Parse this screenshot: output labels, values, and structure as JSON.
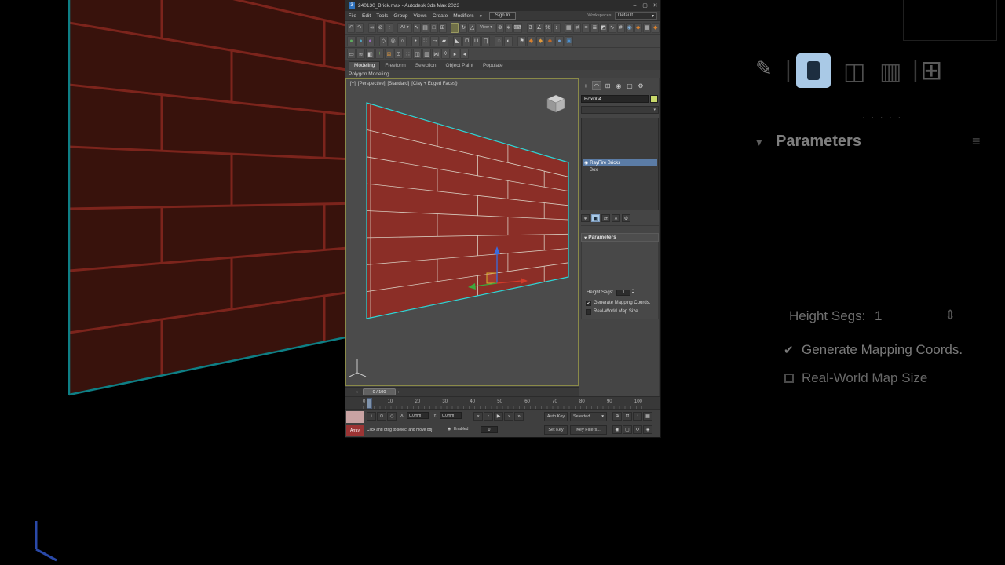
{
  "colors": {
    "brick": "#8b2e27",
    "mortar": "#d9ccbf",
    "selection": "#2fd4d4",
    "axis_x": "#d23b2a",
    "axis_y": "#3da83d",
    "axis_z": "#3a6bdd",
    "bg_brick": "#38120c",
    "bg_mortar": "#7c241c",
    "bg_selection": "#0e7f85",
    "accent_blue": "#a9c9e6",
    "swatch": "#c9d96b"
  },
  "window": {
    "title": "240130_Brick.max - Autodesk 3ds Max 2023",
    "minimize": "–",
    "maximize": "▢",
    "close": "✕"
  },
  "menubar": {
    "items": [
      "File",
      "Edit",
      "Tools",
      "Group",
      "Views",
      "Create",
      "Modifiers"
    ],
    "overflow": "»",
    "sign_in": "Sign In",
    "workspaces_label": "Workspaces:",
    "workspace_value": "Default",
    "caret": "▾"
  },
  "toolbar_row1": [
    {
      "name": "undo-icon",
      "glyph": "↶"
    },
    {
      "name": "redo-icon",
      "glyph": "↷"
    },
    {
      "sep": true
    },
    {
      "name": "select-and-link-icon",
      "glyph": "∞"
    },
    {
      "name": "unlink-selection-icon",
      "glyph": "⊘"
    },
    {
      "name": "bind-to-space-warp-icon",
      "glyph": "≀"
    },
    {
      "sep": true
    },
    {
      "name": "selection-filter-dropdown",
      "glyph": "All ▾",
      "width": 20
    },
    {
      "name": "select-object-icon",
      "glyph": "↖"
    },
    {
      "name": "select-by-name-icon",
      "glyph": "▤"
    },
    {
      "name": "selection-region-icon",
      "glyph": "□"
    },
    {
      "name": "window-crossing-icon",
      "glyph": "⊞"
    },
    {
      "sep": true
    },
    {
      "name": "select-and-move-icon",
      "glyph": "+",
      "active": true
    },
    {
      "name": "select-and-rotate-icon",
      "glyph": "↻"
    },
    {
      "name": "select-and-scale-icon",
      "glyph": "△"
    },
    {
      "name": "reference-coordinate-dropdown",
      "glyph": "View ▾",
      "width": 26
    },
    {
      "name": "use-pivot-center-icon",
      "glyph": "⊕"
    },
    {
      "name": "select-and-manipulate-icon",
      "glyph": "∗"
    },
    {
      "name": "keyboard-shortcut-override-icon",
      "glyph": "⌨"
    },
    {
      "sep": true
    },
    {
      "name": "snaps-toggle-icon",
      "glyph": "3"
    },
    {
      "name": "angle-snap-icon",
      "glyph": "∠"
    },
    {
      "name": "percent-snap-icon",
      "glyph": "%"
    },
    {
      "name": "spinner-snap-icon",
      "glyph": "↕"
    },
    {
      "sep": true
    },
    {
      "name": "named-selection-sets-icon",
      "glyph": "▦"
    },
    {
      "name": "mirror-icon",
      "glyph": "⇄"
    },
    {
      "name": "align-icon",
      "glyph": "≡"
    },
    {
      "name": "layer-manager-icon",
      "glyph": "≣"
    },
    {
      "name": "ribbon-toggle-icon",
      "glyph": "◩"
    },
    {
      "name": "curve-editor-icon",
      "glyph": "∿"
    },
    {
      "name": "schematic-view-icon",
      "glyph": "#"
    },
    {
      "name": "material-editor-icon",
      "glyph": "◉",
      "color": "#7fb2e0"
    },
    {
      "name": "render-setup-icon",
      "glyph": "◆",
      "color": "#d8812f"
    },
    {
      "name": "rendered-frame-window-icon",
      "glyph": "▦"
    },
    {
      "name": "render-production-icon",
      "glyph": "◆",
      "color": "#d8812f"
    }
  ],
  "toolbar_row2": [
    {
      "name": "snap-2d-icon",
      "glyph": "●",
      "color": "#5fae5f"
    },
    {
      "name": "snap-25d-icon",
      "glyph": "●",
      "color": "#53a3c2"
    },
    {
      "name": "snap-3d-icon",
      "glyph": "●",
      "color": "#9c6cc4"
    },
    {
      "sep": true
    },
    {
      "name": "poly-selection-icon",
      "glyph": "◇"
    },
    {
      "name": "soft-selection-icon",
      "glyph": "◎"
    },
    {
      "name": "edge-constraint-icon",
      "glyph": "∩"
    },
    {
      "sep": true
    },
    {
      "name": "vertex-mode-icon",
      "glyph": "•"
    },
    {
      "name": "edge-mode-icon",
      "glyph": "∷"
    },
    {
      "name": "border-mode-icon",
      "glyph": "▱"
    },
    {
      "name": "polygon-mode-icon",
      "glyph": "▰"
    },
    {
      "sep": true
    },
    {
      "name": "chamfer-icon",
      "glyph": "◣"
    },
    {
      "name": "extrude-icon",
      "glyph": "⊓"
    },
    {
      "name": "bevel-icon",
      "glyph": "⊔"
    },
    {
      "name": "bridge-icon",
      "glyph": "∏"
    },
    {
      "sep": true
    },
    {
      "name": "isolate-selection-icon",
      "glyph": "◌"
    },
    {
      "name": "display-toggle-icon",
      "glyph": "◐"
    },
    {
      "sep": true
    },
    {
      "name": "render-flags-icon",
      "glyph": "⚑"
    },
    {
      "name": "render-teapot-icon",
      "glyph": "◆",
      "color": "#d8812f"
    },
    {
      "name": "render-iterative-icon",
      "glyph": "◆",
      "color": "#e09a3e"
    },
    {
      "name": "render-preview-icon",
      "glyph": "◆",
      "color": "#c06a28"
    },
    {
      "name": "material-ball-icon",
      "glyph": "●",
      "color": "#6aa0d8"
    },
    {
      "name": "render-last-icon",
      "glyph": "▣",
      "color": "#4a90d0"
    }
  ],
  "toolbar_row3": [
    {
      "name": "grid-toggle-icon",
      "glyph": "▭"
    },
    {
      "name": "wave-icon",
      "glyph": "≋"
    },
    {
      "name": "half-shade-icon",
      "glyph": "◧"
    },
    {
      "name": "add-mesh-icon",
      "glyph": "+",
      "color": "#7fbf5f"
    },
    {
      "name": "cross-section-icon",
      "glyph": "⊠",
      "color": "#cf8f3f"
    },
    {
      "name": "boolean-icon",
      "glyph": "⊡"
    },
    {
      "name": "lattice-icon",
      "glyph": "∷"
    },
    {
      "name": "panel-split-icon",
      "glyph": "◫"
    },
    {
      "name": "rows-icon",
      "glyph": "▥"
    },
    {
      "name": "connect-icon",
      "glyph": "⋈"
    },
    {
      "name": "diamond-icon",
      "glyph": "◊"
    },
    {
      "name": "play-small-icon",
      "glyph": "▸"
    },
    {
      "name": "detail-icon",
      "glyph": "◂"
    }
  ],
  "ribbon": {
    "tabs": [
      {
        "name": "tab-modeling",
        "label": "Modeling",
        "active": true
      },
      {
        "name": "tab-freeform",
        "label": "Freeform"
      },
      {
        "name": "tab-selection",
        "label": "Selection"
      },
      {
        "name": "tab-object-paint",
        "label": "Object Paint"
      },
      {
        "name": "tab-populate",
        "label": "Populate"
      }
    ],
    "panel_label": "Polygon Modeling"
  },
  "viewport": {
    "label_segments": [
      {
        "name": "viewport-general-menu",
        "label": "[+]"
      },
      {
        "name": "viewport-pov-menu",
        "label": "[Perspective]"
      },
      {
        "name": "viewport-standard-menu",
        "label": "[Standard]"
      },
      {
        "name": "viewport-shading-menu",
        "label": "[Clay + Edged Faces]"
      }
    ],
    "menu_caret": "▽"
  },
  "command_panel": {
    "tabs": [
      {
        "name": "create-tab-icon",
        "glyph": "+"
      },
      {
        "name": "modify-tab-icon",
        "glyph": "◠",
        "active": true
      },
      {
        "name": "hierarchy-tab-icon",
        "glyph": "⊞"
      },
      {
        "name": "motion-tab-icon",
        "glyph": "◉"
      },
      {
        "name": "display-tab-icon",
        "glyph": "▢"
      },
      {
        "name": "utilities-tab-icon",
        "glyph": "⚙"
      }
    ],
    "object_name": "Box004",
    "modifier_list_caret": "▾",
    "stack": [
      {
        "label": "RayFire Bricks"
      },
      {
        "label": "Box"
      }
    ],
    "stack_buttons": [
      {
        "name": "pin-stack-icon",
        "glyph": "∗"
      },
      {
        "name": "show-end-result-icon",
        "glyph": "▣",
        "active": true
      },
      {
        "name": "make-unique-icon",
        "glyph": "⇄"
      },
      {
        "name": "remove-modifier-icon",
        "glyph": "✕"
      },
      {
        "name": "configure-modifier-sets-icon",
        "glyph": "⚙"
      }
    ],
    "rollout": {
      "caret": "▾",
      "title": "Parameters",
      "height_segs_label": "Height Segs:",
      "height_segs_value": "1",
      "check_glyph": "✔",
      "generate_mapping_label": "Generate Mapping Coords.",
      "real_world_label": "Real-World Map Size"
    }
  },
  "timeline": {
    "prev": "‹",
    "next": "›",
    "thumb_label": "0 / 100",
    "ticks": [
      "0",
      "10",
      "20",
      "30",
      "40",
      "50",
      "60",
      "70",
      "80",
      "90",
      "100"
    ]
  },
  "status_bar": {
    "listener_text": "Array",
    "prompt": "Click and drag to select and move obj",
    "mini_icons": [
      {
        "name": "isolate-toggle-icon",
        "glyph": "i"
      },
      {
        "name": "selection-lock-icon",
        "glyph": "⊙"
      },
      {
        "name": "absolute-mode-icon",
        "glyph": "◇"
      }
    ],
    "coord_x_label": "X:",
    "coord_x_value": "0,0mm",
    "coord_y_label": "Y:",
    "coord_y_value": "0,0mm",
    "spinner_up": "▴",
    "spinner_down": "▾",
    "enabled_icon": "◉",
    "enabled_label": "Enabled",
    "frame_value": "0",
    "transport": [
      {
        "name": "go-to-start-icon",
        "glyph": "«"
      },
      {
        "name": "previous-frame-icon",
        "glyph": "‹"
      },
      {
        "name": "play-icon",
        "glyph": "▶"
      },
      {
        "name": "next-frame-icon",
        "glyph": "›"
      },
      {
        "name": "go-to-end-icon",
        "glyph": "»"
      }
    ],
    "auto_key": "Auto Key",
    "selected_filter": "Selected",
    "caret": "▾",
    "set_key": "Set Key",
    "key_filters": "Key Filters...",
    "nav_top": [
      {
        "name": "zoom-icon",
        "glyph": "⊕"
      },
      {
        "name": "zoom-all-icon",
        "glyph": "⊡"
      },
      {
        "name": "zoom-extents-icon",
        "glyph": "↕"
      },
      {
        "name": "maximize-viewport-icon",
        "glyph": "▦"
      }
    ],
    "nav_bottom": [
      {
        "name": "field-of-view-icon",
        "glyph": "◉"
      },
      {
        "name": "pan-icon",
        "glyph": "▢"
      },
      {
        "name": "orbit-icon",
        "glyph": "↺"
      },
      {
        "name": "isolate-nav-icon",
        "glyph": "◈"
      }
    ]
  },
  "backdrop": {
    "pin_glyph": "✎",
    "divider": "|",
    "dots": "· · · · ·",
    "caret": "▾",
    "title": "Parameters",
    "grip": "≡",
    "tab2_glyph": "◫",
    "tab3_glyph": "▥",
    "tab4_glyph": "⊞",
    "height_segs_label": "Height Segs:",
    "height_segs_value": "1",
    "spinner": "⇕",
    "check": "✔",
    "generate_mapping": "Generate Mapping Coords.",
    "real_world": "Real-World Map Size"
  }
}
